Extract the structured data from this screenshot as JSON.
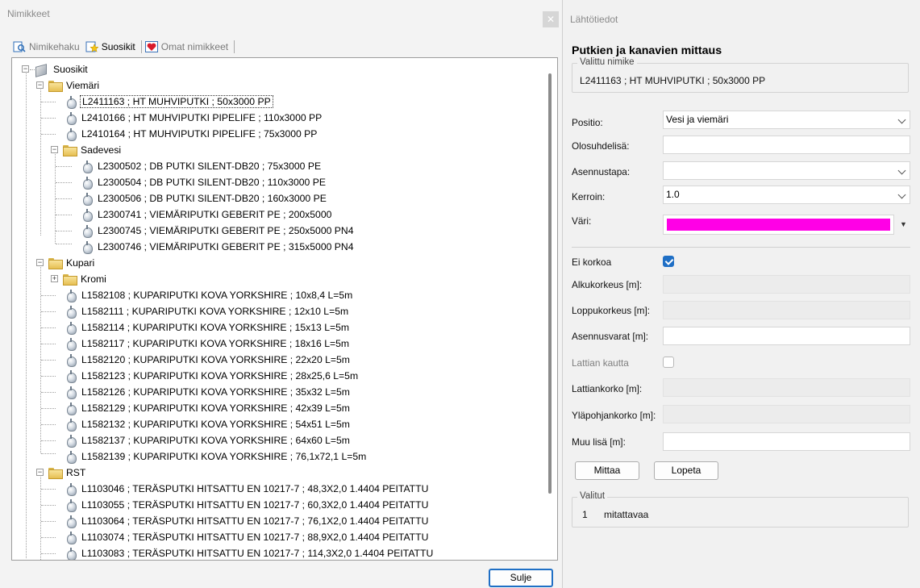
{
  "left_panel": {
    "title": "Nimikkeet",
    "close_icon": "✕",
    "tabs": [
      {
        "label": "Nimikehaku",
        "icon": "search-doc-icon"
      },
      {
        "label": "Suosikit",
        "icon": "star-doc-icon"
      },
      {
        "label": "Omat nimikkeet",
        "icon": "heart-icon"
      }
    ],
    "tree": {
      "root": "Suosikit",
      "viemari": "Viemäri",
      "viemari_items": [
        "L2411163 ; HT MUHVIPUTKI ; 50x3000 PP",
        "L2410166 ; HT MUHVIPUTKI PIPELIFE ; 110x3000 PP",
        "L2410164 ; HT MUHVIPUTKI PIPELIFE ; 75x3000 PP"
      ],
      "sadevesi": "Sadevesi",
      "sadevesi_items": [
        "L2300502 ; DB PUTKI SILENT-DB20 ; 75x3000 PE",
        "L2300504 ; DB PUTKI SILENT-DB20 ; 110x3000 PE",
        "L2300506 ; DB PUTKI SILENT-DB20 ; 160x3000 PE",
        "L2300741 ; VIEMÄRIPUTKI GEBERIT PE ; 200x5000",
        "L2300745 ; VIEMÄRIPUTKI GEBERIT PE ; 250x5000 PN4",
        "L2300746 ; VIEMÄRIPUTKI GEBERIT PE ; 315x5000 PN4"
      ],
      "kupari": "Kupari",
      "kromi": "Kromi",
      "kupari_items": [
        "L1582108 ; KUPARIPUTKI KOVA YORKSHIRE ; 10x8,4 L=5m",
        "L1582111 ; KUPARIPUTKI KOVA YORKSHIRE ; 12x10 L=5m",
        "L1582114 ; KUPARIPUTKI KOVA YORKSHIRE ; 15x13 L=5m",
        "L1582117 ; KUPARIPUTKI KOVA YORKSHIRE ; 18x16 L=5m",
        "L1582120 ; KUPARIPUTKI KOVA YORKSHIRE ; 22x20 L=5m",
        "L1582123 ; KUPARIPUTKI KOVA YORKSHIRE ; 28x25,6 L=5m",
        "L1582126 ; KUPARIPUTKI KOVA YORKSHIRE ; 35x32 L=5m",
        "L1582129 ; KUPARIPUTKI KOVA YORKSHIRE ; 42x39 L=5m",
        "L1582132 ; KUPARIPUTKI KOVA YORKSHIRE ; 54x51 L=5m",
        "L1582137 ; KUPARIPUTKI KOVA YORKSHIRE ; 64x60 L=5m",
        "L1582139 ; KUPARIPUTKI KOVA YORKSHIRE ; 76,1x72,1 L=5m"
      ],
      "rst": "RST",
      "rst_items": [
        "L1103046 ; TERÄSPUTKI HITSATTU EN 10217-7 ; 48,3X2,0 1.4404 PEITATTU",
        "L1103055 ; TERÄSPUTKI HITSATTU EN 10217-7 ; 60,3X2,0 1.4404 PEITATTU",
        "L1103064 ; TERÄSPUTKI HITSATTU EN 10217-7 ; 76,1X2,0 1.4404 PEITATTU",
        "L1103074 ; TERÄSPUTKI HITSATTU EN 10217-7 ; 88,9X2,0 1.4404 PEITATTU",
        "L1103083 ; TERÄSPUTKI HITSATTU EN 10217-7 ; 114,3X2,0 1.4404 PEITATTU"
      ]
    },
    "close_button": "Sulje"
  },
  "right_panel": {
    "title": "Lähtötiedot",
    "heading": "Putkien ja kanavien mittaus",
    "selected_group_label": "Valittu nimike",
    "selected_item": "L2411163 ; HT MUHVIPUTKI ; 50x3000 PP",
    "fields": {
      "positio_label": "Positio:",
      "positio_value": "Vesi ja viemäri",
      "olosuhdelisa_label": "Olosuhdelisä:",
      "olosuhdelisa_value": "",
      "asennustapa_label": "Asennustapa:",
      "asennustapa_value": "",
      "kerroin_label": "Kerroin:",
      "kerroin_value": "1.0",
      "vari_label": "Väri:",
      "vari_color": "#ff00e6",
      "ei_korkoa_label": "Ei korkoa",
      "ei_korkoa_checked": true,
      "alkukorkeus_label": "Alkukorkeus [m]:",
      "loppukorkeus_label": "Loppukorkeus [m]:",
      "asennusvarat_label": "Asennusvarat [m]:",
      "asennusvarat_value": "",
      "lattian_kautta_label": "Lattian kautta",
      "lattian_kautta_checked": false,
      "lattiankorko_label": "Lattiankorko [m]:",
      "ylapohjankorko_label": "Yläpohjankorko [m]:",
      "muu_lisa_label": "Muu lisä [m]:",
      "muu_lisa_value": ""
    },
    "measure_button": "Mittaa",
    "stop_button": "Lopeta",
    "valitut_label": "Valitut",
    "valitut_count": "1",
    "valitut_text": "mitattavaa"
  },
  "colors": {
    "accent": "#1f6fc5",
    "selected_color": "#ff00e6"
  }
}
